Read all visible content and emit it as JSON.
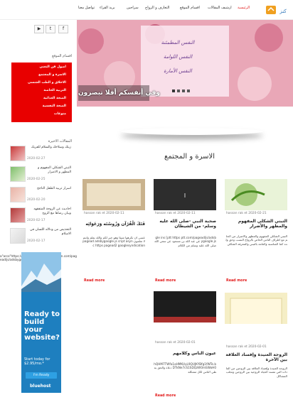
{
  "nav": {
    "items": [
      "الرئيسية",
      "ارشيف المقالات",
      "اقسام الموقع",
      "التعارف و الزواج",
      "سراجين",
      "بريد القراء",
      "تواصل معنا"
    ],
    "active_index": 0,
    "logo_text": "كنز"
  },
  "social": {
    "facebook": "f",
    "twitter": "t",
    "youtube": "▶"
  },
  "sidebar": {
    "menu_title": "اقسام الموقع",
    "menu_items": [
      "اصول فن التغني",
      "الاسرة و المجتمع",
      "الاخلاق و الطب الجنسي",
      "التربية الخاصة",
      "الصحة الغذائية",
      "الصحة النفسية",
      "منوعات"
    ],
    "recent_title": "المقالات الاخيرة",
    "recent": [
      {
        "title": "زيتك وسلاحك والسلام للفريك",
        "date": "2020-02-27"
      },
      {
        "title": "التبني الشكلي المفهوم و المظهر و الاضرار",
        "date": "2020-02-25"
      },
      {
        "title": "اسرار تربيه الطفل الناجح",
        "date": "2020-02-20"
      },
      {
        "title": "احاديث عن الزوجة المتفقهه وبيان رضاها مع الزوج",
        "date": "2020-02-17"
      },
      {
        "title": "التحذيص من ودلاله اللسان في الاسلام",
        "date": "2020-02-17"
      }
    ],
    "ad_link": "a\"arco\"https://pagead2.googlesyndication.com/pagead/js/adsbygoogle.js",
    "ad": {
      "headline": "Ready to build your website?",
      "offer": "Start today for $2.95/mo.*",
      "button": "I'm Ready",
      "brand": "bluehost"
    }
  },
  "slider": {
    "caption": "وفي أنفسكم أفلا تبصرون",
    "lines": [
      "النفس المطمئنة",
      "النفس اللوامة",
      "النفس الأمارة"
    ],
    "dots": 4
  },
  "section": {
    "title": "الاسرة و المجتمع"
  },
  "cards": [
    {
      "author": "hassan rak et",
      "date": "2020-02-21",
      "title": "التبني الشكلي المفهوم والمظهر والأضرار",
      "text": "التبني الشكلي المفهوم والمظهر والاضرار من الحلم مع اطراف الناس الخاص بالزواج النسب وحق ولده كما المناسبة والعامة بالتبني والمعرفة الشكلي",
      "read_more": "Read more"
    },
    {
      "author": "hassan rak et",
      "date": "2020-02-11",
      "title": "صحبة النبي -صلى الله عليه وسلم- من الشيطان",
      "text": "gle ins [ptt https ptt.com/pagead/js/adsbygoogle.js عن عبد الله بن مسعود عن سعي الله صلى الله عليه وسلم من الكلام",
      "read_more": "Read more"
    },
    {
      "author": "hassan rak et",
      "date": "2020-02-11",
      "title": "فَتَكَ الْقُرْآن وَزُوسُتَه وَرَعَوَائِه",
      "text": "عسى ان تكرهوا شيئا وهو خير لكم والله يعلم وانتم لا تعلمون pagead adsbygoogle.js cript async https pagead2 googlesyndication",
      "read_more": "Read more"
    },
    {
      "author": "hassan rak et",
      "date": "2020-02-01",
      "title": "الزوجة العنيدة وإفساد العلاقة بين الآخرة",
      "text": "الزوجة العنيدة وإفساد العلاقة بين الزوجين من العادات التي تفسد الحياة الزوجية بين الزوجين وتجلب المشاكل",
      "read_more": "Read more"
    },
    {
      "author": "hassan rak et",
      "date": "2020-02-01",
      "title": "عيون الناس وكلامهم",
      "text": "hQHM7TWfa1aHMKUyL9QUJKYBfg1fWTe.bDTkNe7cS1SDQzW0mSWoH0 دعاة والحق يعطي الناس لكل مشكلة",
      "read_more": "Read more"
    }
  ]
}
